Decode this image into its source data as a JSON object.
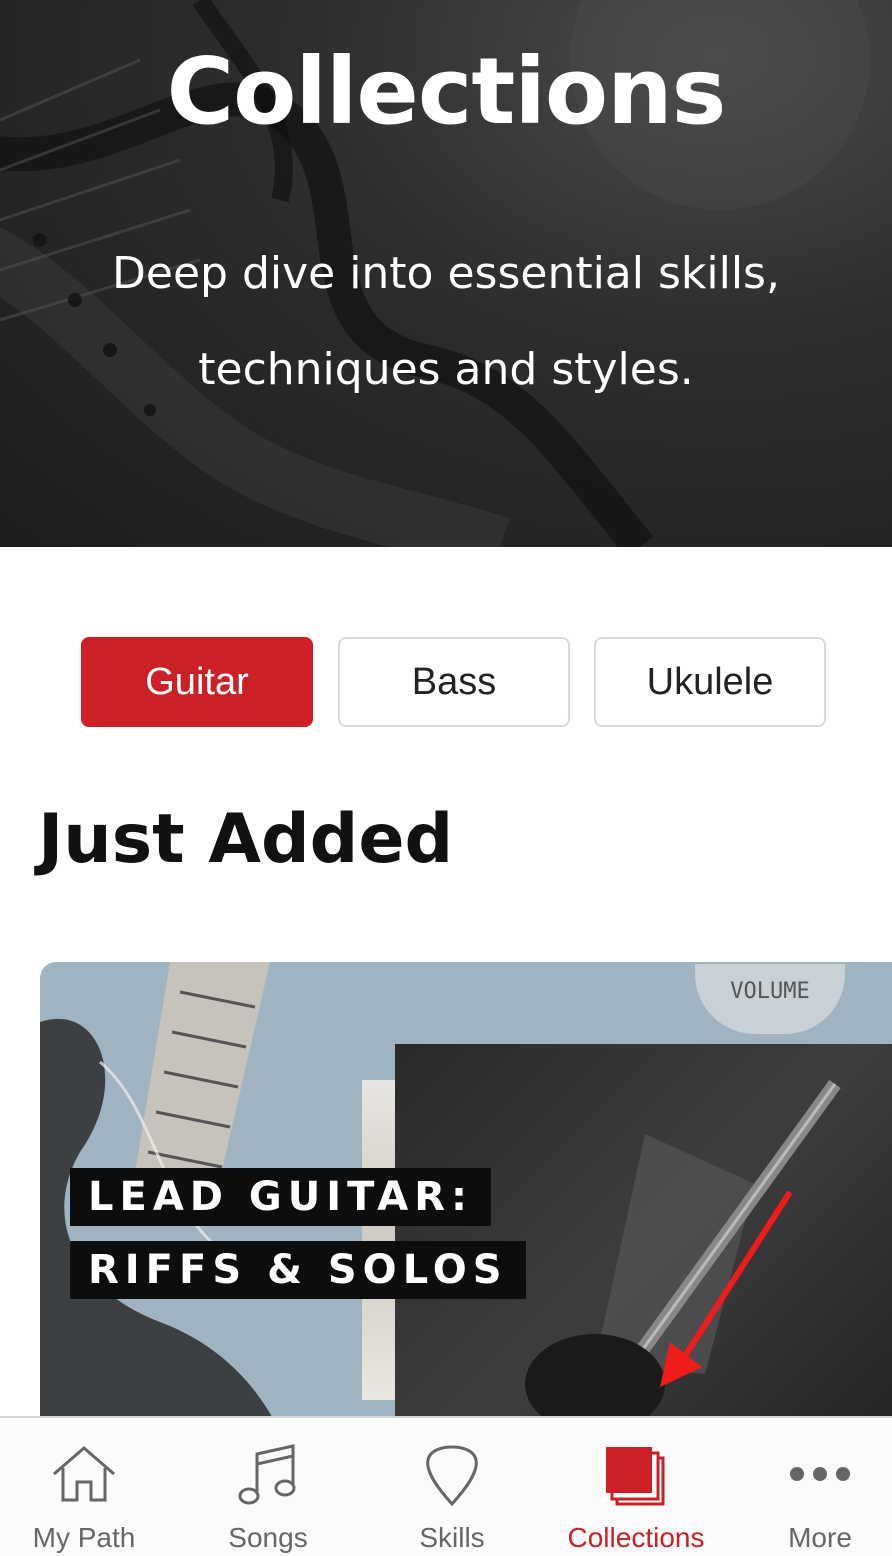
{
  "hero": {
    "title": "Collections",
    "subtitle": "Deep dive into essential skills, techniques and styles."
  },
  "filters": {
    "items": [
      {
        "label": "Guitar",
        "active": true
      },
      {
        "label": "Bass",
        "active": false
      },
      {
        "label": "Ukulele",
        "active": false
      }
    ]
  },
  "section": {
    "title": "Just Added"
  },
  "card": {
    "title_line1": "LEAD GUITAR:",
    "title_line2": "RIFFS & SOLOS",
    "knob_text": "VOLUME"
  },
  "tabbar": {
    "items": [
      {
        "label": "My Path",
        "icon": "home-icon"
      },
      {
        "label": "Songs",
        "icon": "music-note-icon"
      },
      {
        "label": "Skills",
        "icon": "guitar-pick-icon"
      },
      {
        "label": "Collections",
        "icon": "stack-icon",
        "active": true
      },
      {
        "label": "More",
        "icon": "more-icon"
      }
    ]
  },
  "colors": {
    "accent": "#cc1f26",
    "hero_bg": "#2e2e2e",
    "card_bg": "#9fb3c1"
  }
}
